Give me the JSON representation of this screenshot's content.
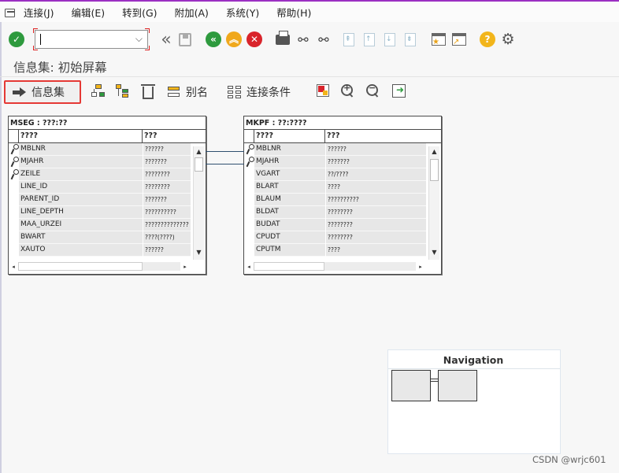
{
  "menu": [
    "连接(J)",
    "编辑(E)",
    "转到(G)",
    "附加(A)",
    "系统(Y)",
    "帮助(H)"
  ],
  "command_field": {
    "value": ""
  },
  "title": "信息集: 初始屏幕",
  "app_toolbar": {
    "info_set_label": "信息集",
    "alias_label": "别名",
    "join_label": "连接条件"
  },
  "tables": [
    {
      "title": "MSEG : ???:??",
      "col1": "????",
      "col2": "???",
      "rows": [
        {
          "name": "MBLNR",
          "desc": "??????",
          "key": true
        },
        {
          "name": "MJAHR",
          "desc": "???????",
          "key": true
        },
        {
          "name": "ZEILE",
          "desc": "????????",
          "key": true
        },
        {
          "name": "LINE_ID",
          "desc": "????????",
          "key": false
        },
        {
          "name": "PARENT_ID",
          "desc": "???????",
          "key": false
        },
        {
          "name": "LINE_DEPTH",
          "desc": "??????????",
          "key": false
        },
        {
          "name": "MAA_URZEI",
          "desc": "??????????????",
          "key": false
        },
        {
          "name": "BWART",
          "desc": "????(????)",
          "key": false
        },
        {
          "name": "XAUTO",
          "desc": "??????",
          "key": false
        }
      ]
    },
    {
      "title": "MKPF : ??:????",
      "col1": "????",
      "col2": "???",
      "rows": [
        {
          "name": "MBLNR",
          "desc": "??????",
          "key": true
        },
        {
          "name": "MJAHR",
          "desc": "???????",
          "key": true
        },
        {
          "name": "VGART",
          "desc": "??/????",
          "key": false
        },
        {
          "name": "BLART",
          "desc": "????",
          "key": false
        },
        {
          "name": "BLAUM",
          "desc": "??????????",
          "key": false
        },
        {
          "name": "BLDAT",
          "desc": "????????",
          "key": false
        },
        {
          "name": "BUDAT",
          "desc": "????????",
          "key": false
        },
        {
          "name": "CPUDT",
          "desc": "????????",
          "key": false
        },
        {
          "name": "CPUTM",
          "desc": "????",
          "key": false
        }
      ]
    }
  ],
  "navigation": {
    "title": "Navigation"
  },
  "watermark": "CSDN @wrjc601"
}
